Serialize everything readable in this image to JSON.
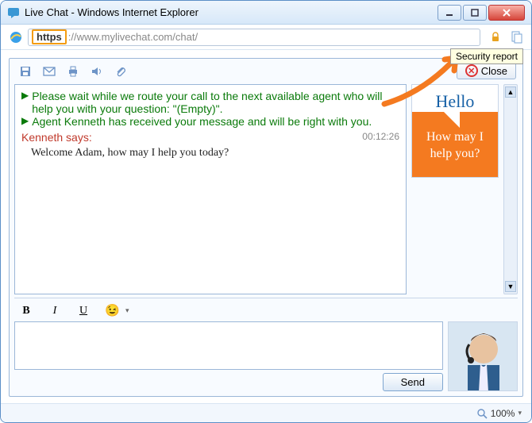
{
  "window": {
    "title": "Live Chat - Windows Internet Explorer"
  },
  "url": {
    "scheme": "https",
    "rest": "://www.mylivechat.com/chat/"
  },
  "tooltip": "Security report",
  "toolbar": {
    "icons": {
      "save": "save-icon",
      "email": "email-icon",
      "print": "print-icon",
      "sound": "sound-icon",
      "attach": "attach-icon"
    },
    "close_label": "Close"
  },
  "transcript": {
    "sys1": "Please wait while we route your call to the next available agent who will help you with your question: \"(Empty)\".",
    "sys2": "Agent Kenneth has received your message and will be right with you.",
    "says": "Kenneth says:",
    "timestamp": "00:12:26",
    "msg1": "Welcome Adam, how may I help you today?"
  },
  "promo": {
    "hello": "Hello",
    "text": "How may I help you?"
  },
  "format": {
    "bold": "B",
    "italic": "I",
    "underline": "U"
  },
  "send_label": "Send",
  "status": {
    "zoom": "100%"
  }
}
